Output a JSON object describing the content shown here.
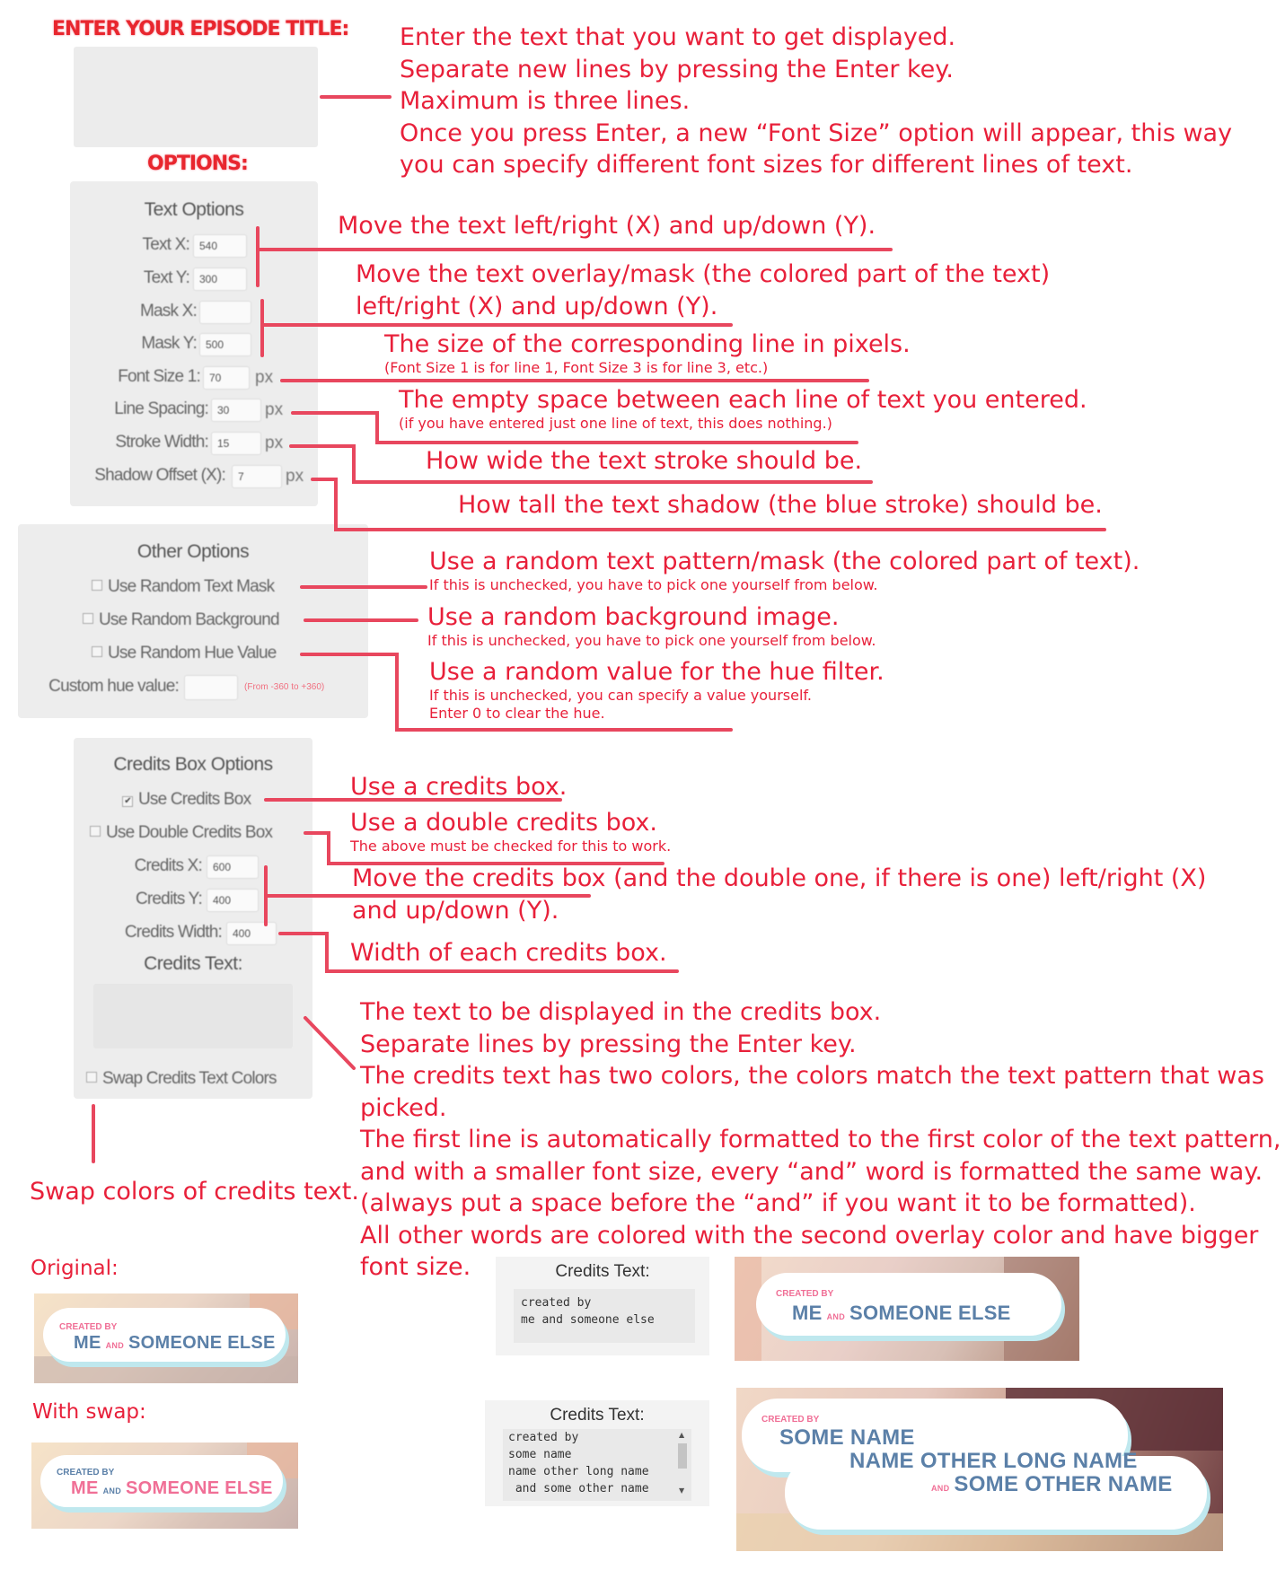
{
  "colors": {
    "annotation": "#e8203a",
    "pointer_line": "#e8475e",
    "panel_bg": "#ededed"
  },
  "headers": {
    "episode_title": "ENTER YOUR EPISODE TITLE:",
    "options": "OPTIONS:"
  },
  "text_options": {
    "title": "Text Options",
    "fields": [
      {
        "label": "Text X:",
        "value": "540",
        "unit": ""
      },
      {
        "label": "Text Y:",
        "value": "300",
        "unit": ""
      },
      {
        "label": "Mask X:",
        "value": "",
        "unit": ""
      },
      {
        "label": "Mask Y:",
        "value": "500",
        "unit": ""
      },
      {
        "label": "Font Size 1:",
        "value": "70",
        "unit": "px"
      },
      {
        "label": "Line Spacing:",
        "value": "30",
        "unit": "px"
      },
      {
        "label": "Stroke Width:",
        "value": "15",
        "unit": "px"
      },
      {
        "label": "Shadow Offset (X):",
        "value": "7",
        "unit": "px"
      }
    ]
  },
  "other_options": {
    "title": "Other Options",
    "checkboxes": [
      "Use Random Text Mask",
      "Use Random Background",
      "Use Random Hue Value"
    ],
    "custom_hue_label": "Custom hue value:",
    "custom_hue_hint": "(From -360 to +360)"
  },
  "credits_options": {
    "title": "Credits Box Options",
    "use_credits_box": "Use Credits Box",
    "use_double_credits_box": "Use Double Credits Box",
    "fields": [
      {
        "label": "Credits X:",
        "value": "600"
      },
      {
        "label": "Credits Y:",
        "value": "400"
      },
      {
        "label": "Credits Width:",
        "value": "400"
      }
    ],
    "credits_text_label": "Credits Text:",
    "swap_colors": "Swap Credits Text Colors"
  },
  "annotations": {
    "episode_title": [
      "Enter the text that you want to get displayed.",
      "Separate new lines by pressing the Enter key.",
      "Maximum is three lines.",
      "Once you press Enter, a new “Font Size” option will appear, this way",
      "you can specify different font sizes for different lines of text."
    ],
    "text_xy": "Move the text left/right (X) and up/down (Y).",
    "mask_xy": [
      "Move the text overlay/mask (the colored part of the text)",
      "left/right (X) and up/down (Y)."
    ],
    "font_size": "The size of the corresponding line in pixels.",
    "font_size_note": "(Font Size 1 is for line 1, Font Size 3 is for line 3, etc.)",
    "line_spacing": "The empty space between each line of text you entered.",
    "line_spacing_note": "(if you have entered just one line of text, this does nothing.)",
    "stroke_width": "How wide the text stroke should be.",
    "shadow_offset": "How tall the text shadow (the blue stroke) should be.",
    "random_mask": "Use a random text pattern/mask (the colored part of text).",
    "random_mask_note": "If this is unchecked, you have to pick one yourself from below.",
    "random_bg": "Use a random background image.",
    "random_bg_note": "If this is unchecked, you have to pick one yourself from below.",
    "random_hue": "Use a random value for the hue filter.",
    "random_hue_note1": "If this is unchecked, you can specify a value yourself.",
    "random_hue_note2": "Enter 0 to clear the hue.",
    "credits_box": "Use a credits box.",
    "double_box": "Use a double credits box.",
    "double_box_note": "The above must be checked for this to work.",
    "credits_xy": [
      "Move the credits box (and the double one, if there is one) left/right (X)",
      "and up/down (Y)."
    ],
    "credits_width": "Width of each credits box.",
    "credits_text": [
      "The text to be displayed in the credits box.",
      "Separate lines by pressing the Enter key.",
      "The credits text has two colors, the colors match the text pattern that was",
      "picked.",
      "The first line is automatically formatted to the first color of the text pattern,",
      "and with a smaller font size, every “and” word is formatted the same way.",
      "(always put a space before the “and” if you want it to be formatted).",
      "All other words are colored with the second overlay color and have bigger",
      "font size."
    ],
    "swap": "Swap colors of credits text."
  },
  "examples": {
    "original_label": "Original:",
    "swap_label": "With swap:",
    "created_by": "CREATED BY",
    "name_a": "ME",
    "and_word": "AND",
    "name_b": "SOMEONE ELSE",
    "credits_text_label": "Credits Text:",
    "textarea1": "created by\nme and someone else",
    "textarea2": "created by\nsome name\nname other long name\n and some other name",
    "double_line1": "SOME NAME",
    "double_line2": "NAME OTHER LONG NAME",
    "double_line3": "SOME OTHER NAME",
    "pink": "#f06f96",
    "blue": "#5b80a8"
  }
}
